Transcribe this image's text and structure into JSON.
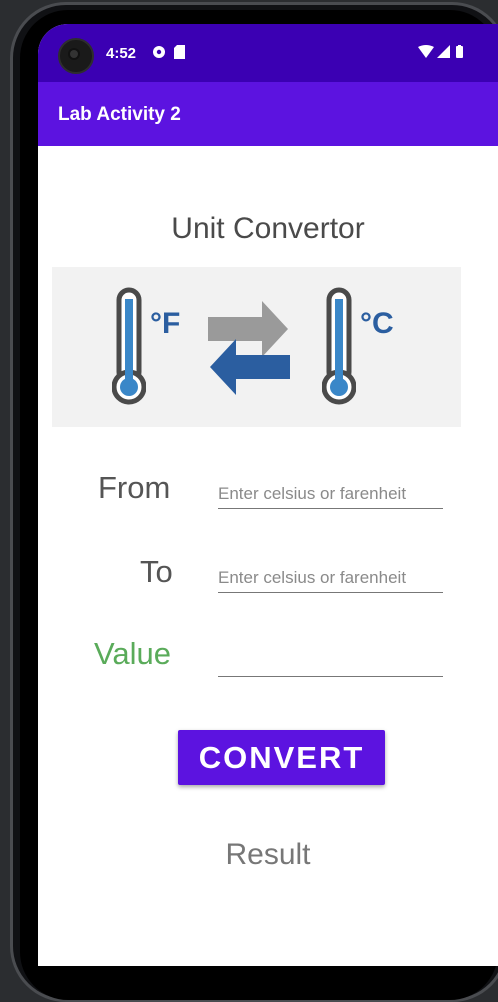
{
  "status_bar": {
    "time": "4:52",
    "notification_icons": [
      "pinwheel-icon",
      "sd-card-icon"
    ],
    "system_icons": [
      "wifi-icon",
      "signal-icon",
      "battery-icon"
    ]
  },
  "app_bar": {
    "title": "Lab Activity 2"
  },
  "main": {
    "heading": "Unit Convertor",
    "banner": {
      "left_unit": "°F",
      "right_unit": "°C",
      "colors": {
        "thermo_blue": "#3a87c8",
        "thermo_outline": "#4a4a4a",
        "arrow_grey": "#9a9a9a",
        "arrow_blue": "#2b5ea0"
      }
    },
    "from": {
      "label": "From",
      "placeholder": "Enter celsius or farenheit",
      "value": ""
    },
    "to": {
      "label": "To",
      "placeholder": "Enter celsius or farenheit",
      "value": ""
    },
    "value": {
      "label": "Value",
      "value": "",
      "label_color": "#5aab5a"
    },
    "convert_button": "CONVERT",
    "result": "Result"
  },
  "colors": {
    "primary": "#5c13e0",
    "status_bar": "#3b00b3"
  }
}
